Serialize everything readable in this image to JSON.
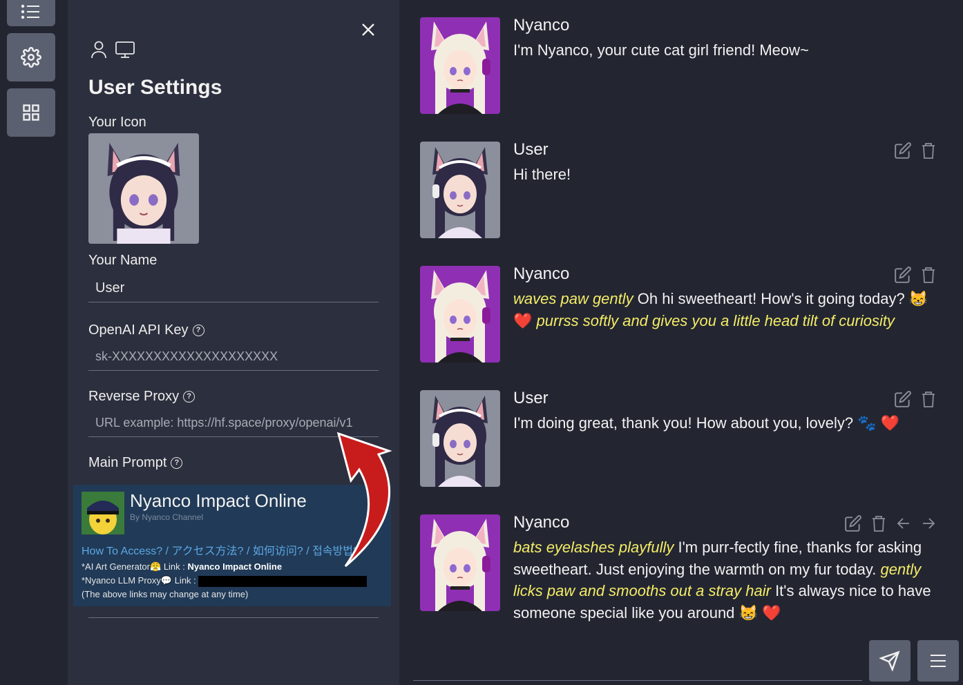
{
  "rail": {
    "items": [
      "list-icon",
      "gear-icon",
      "grid-icon"
    ]
  },
  "settings": {
    "title": "User Settings",
    "icon_label": "Your Icon",
    "name_label": "Your Name",
    "name_value": "User",
    "api_key_label": "OpenAI API Key",
    "api_key_placeholder": "sk-XXXXXXXXXXXXXXXXXXXX",
    "proxy_label": "Reverse Proxy",
    "proxy_placeholder": "URL example: https://hf.space/proxy/openai/v1",
    "main_prompt_label": "Main Prompt"
  },
  "promo": {
    "title": "Nyanco Impact Online",
    "subtitle": "By Nyanco Channel",
    "access_link": "How To Access? / アクセス方法? / 如何访问? / 접속방법?",
    "line1_prefix": "*AI Art Generator",
    "line1_link_label": "Link :",
    "line1_link": "Nyanco Impact Online",
    "line2_prefix": "*Nyanco LLM Proxy",
    "line2_link_label": "Link :",
    "line3": "(The above links may change at any time)"
  },
  "messages": [
    {
      "name": "Nyanco",
      "avatar": "nyanco",
      "parts": [
        {
          "t": "I'm Nyanco, your cute cat girl friend! Meow~",
          "i": false
        }
      ],
      "actions": []
    },
    {
      "name": "User",
      "avatar": "user",
      "parts": [
        {
          "t": "Hi there!",
          "i": false
        }
      ],
      "actions": [
        "edit-icon",
        "trash-icon"
      ]
    },
    {
      "name": "Nyanco",
      "avatar": "nyanco",
      "parts": [
        {
          "t": "waves paw gently",
          "i": true
        },
        {
          "t": " Oh hi sweetheart! How's it going today? 😸 ❤️ ",
          "i": false
        },
        {
          "t": "purrss softly and gives you a little head tilt of curiosity",
          "i": true
        }
      ],
      "actions": [
        "edit-icon",
        "trash-icon"
      ]
    },
    {
      "name": "User",
      "avatar": "user",
      "parts": [
        {
          "t": "I'm doing great, thank you! How about you, lovely? 🐾 ❤️",
          "i": false
        }
      ],
      "actions": [
        "edit-icon",
        "trash-icon"
      ]
    },
    {
      "name": "Nyanco",
      "avatar": "nyanco",
      "parts": [
        {
          "t": "bats eyelashes playfully",
          "i": true
        },
        {
          "t": " I'm purr-fectly fine, thanks for asking sweetheart. Just enjoying the warmth on my fur today. ",
          "i": false
        },
        {
          "t": "gently licks paw and smooths out a stray hair",
          "i": true
        },
        {
          "t": " It's always nice to have someone special like you around 😸 ❤️",
          "i": false
        }
      ],
      "actions": [
        "edit-icon",
        "trash-icon",
        "arrow-left-icon",
        "arrow-right-icon"
      ]
    }
  ],
  "footer": {
    "send": "send-icon",
    "menu": "menu-icon"
  }
}
